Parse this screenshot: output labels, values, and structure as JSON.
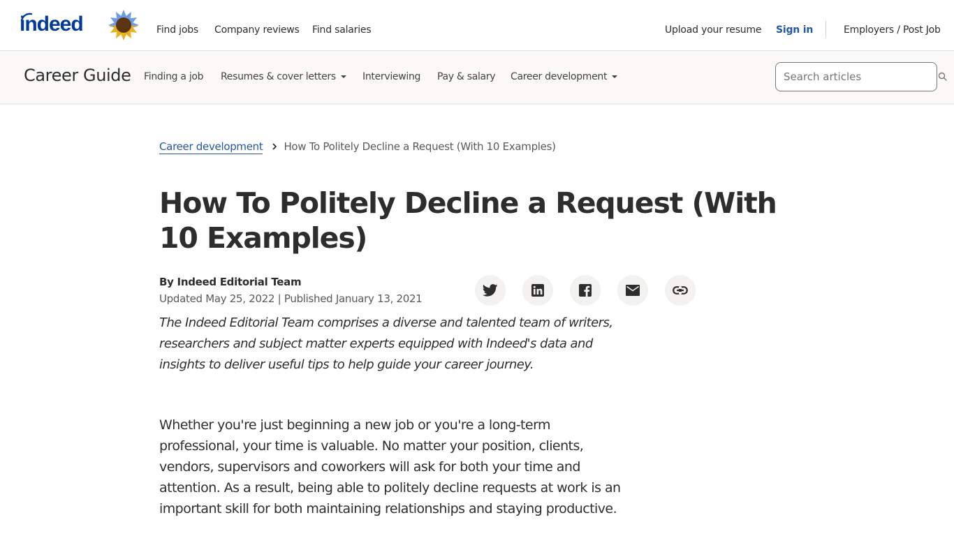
{
  "top_header": {
    "logo_text": "indeed",
    "nav_links": [
      "Find jobs",
      "Company reviews",
      "Find salaries"
    ],
    "right_links": {
      "upload_resume": "Upload your resume",
      "sign_in": "Sign in",
      "employers": "Employers / Post Job"
    }
  },
  "sub_nav": {
    "title": "Career Guide",
    "links": [
      {
        "label": "Finding a job",
        "has_dropdown": false
      },
      {
        "label": "Resumes & cover letters",
        "has_dropdown": true
      },
      {
        "label": "Interviewing",
        "has_dropdown": false
      },
      {
        "label": "Pay & salary",
        "has_dropdown": false
      },
      {
        "label": "Career development",
        "has_dropdown": true
      }
    ],
    "search": {
      "placeholder": "Search articles",
      "value": ""
    }
  },
  "article": {
    "breadcrumb": {
      "parent": "Career development",
      "current": "How To Politely Decline a Request (With 10 Examples)"
    },
    "title": "How To Politely Decline a Request (With 10 Examples)",
    "author": "By Indeed Editorial Team",
    "dates": "Updated May 25, 2022 | Published January 13, 2021",
    "share_icons": [
      "twitter-icon",
      "linkedin-icon",
      "facebook-icon",
      "email-icon",
      "link-icon"
    ],
    "editorial_blurb": "The Indeed Editorial Team comprises a diverse and talented team of writers, researchers and subject matter experts equipped with Indeed's data and insights to deliver useful tips to help guide your career journey.",
    "intro_paragraph": "Whether you're just beginning a new job or you're a long-term professional, your time is valuable. No matter your position, clients, vendors, supervisors and coworkers will ask for both your time and attention. As a result, being able to politely decline requests at work is an important skill for both maintaining relationships and staying productive."
  },
  "colors": {
    "brand_blue": "#003a9b",
    "link_blue": "#2557a7",
    "text": "#2d2d2d",
    "muted_text": "#595959",
    "subnav_bg": "#faf9f8",
    "share_bg": "#f3f2f1"
  }
}
